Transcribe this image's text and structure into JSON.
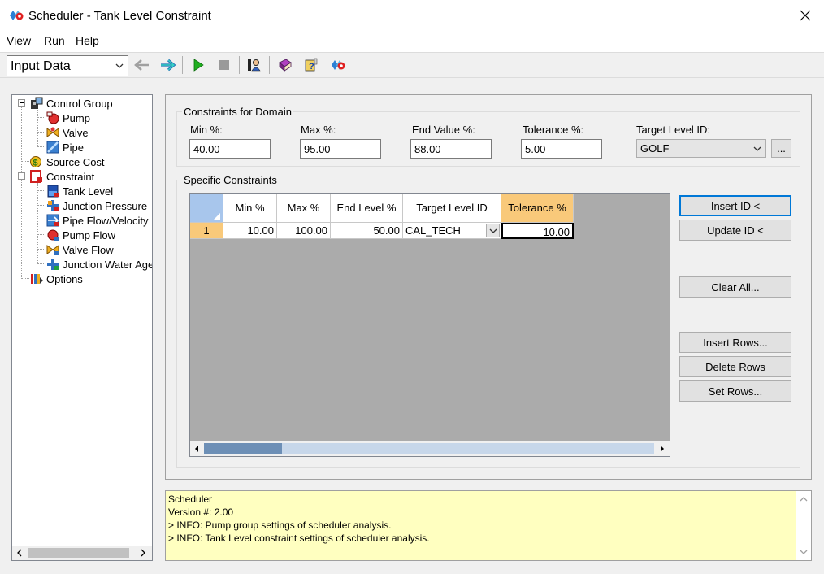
{
  "window": {
    "title": "Scheduler - Tank Level Constraint",
    "close_glyph": "✕"
  },
  "menu": [
    "View",
    "Run",
    "Help"
  ],
  "toolbar": {
    "mode_value": "Input Data",
    "icons": [
      "back-arrow-icon",
      "forward-arrow-icon",
      "run-icon",
      "stop-icon",
      "user-settings-icon",
      "book-icon",
      "help-icon",
      "scheduler-icon"
    ]
  },
  "tree": {
    "items": [
      {
        "label": "Control Group",
        "icon": "control-group-icon"
      },
      {
        "label": "Pump",
        "icon": "pump-icon"
      },
      {
        "label": "Valve",
        "icon": "valve-icon"
      },
      {
        "label": "Pipe",
        "icon": "pipe-icon"
      },
      {
        "label": "Source Cost",
        "icon": "source-cost-icon"
      },
      {
        "label": "Constraint",
        "icon": "constraint-icon"
      },
      {
        "label": "Tank Level",
        "icon": "tank-level-icon"
      },
      {
        "label": "Junction Pressure",
        "icon": "junction-pressure-icon"
      },
      {
        "label": "Pipe Flow/Velocity",
        "icon": "pipe-flow-icon"
      },
      {
        "label": "Pump Flow",
        "icon": "pump-flow-icon"
      },
      {
        "label": "Valve Flow",
        "icon": "valve-flow-icon"
      },
      {
        "label": "Junction Water Age",
        "icon": "junction-water-age-icon"
      },
      {
        "label": "Options",
        "icon": "options-icon"
      }
    ]
  },
  "domain": {
    "title": "Constraints for Domain",
    "min_label": "Min %:",
    "min_value": "40.00",
    "max_label": "Max %:",
    "max_value": "95.00",
    "end_label": "End Value %:",
    "end_value": "88.00",
    "tol_label": "Tolerance %:",
    "tol_value": "5.00",
    "target_label": "Target Level ID:",
    "target_value": "GOLF",
    "browse_label": "..."
  },
  "specific": {
    "title": "Specific Constraints",
    "columns": [
      "",
      "Min %",
      "Max %",
      "End Level %",
      "Target Level ID",
      "Tolerance %"
    ],
    "rows": [
      {
        "num": "1",
        "min": "10.00",
        "max": "100.00",
        "end": "50.00",
        "target": "CAL_TECH",
        "tol": "10.00"
      }
    ]
  },
  "buttons": {
    "insert_id": "Insert ID <",
    "update_id": "Update ID <",
    "clear_all": "Clear All...",
    "insert_rows": "Insert Rows...",
    "delete_rows": "Delete Rows",
    "set_rows": "Set Rows..."
  },
  "info": {
    "lines": [
      "Scheduler",
      "Version #: 2.00",
      "> INFO: Pump group settings of scheduler analysis.",
      "> INFO: Tank Level constraint settings of scheduler analysis."
    ]
  },
  "colors": {
    "selected_header": "#f9c97a",
    "info_bg": "#ffffc0",
    "grid_bg": "#ababab",
    "accent": "#0078d7"
  }
}
